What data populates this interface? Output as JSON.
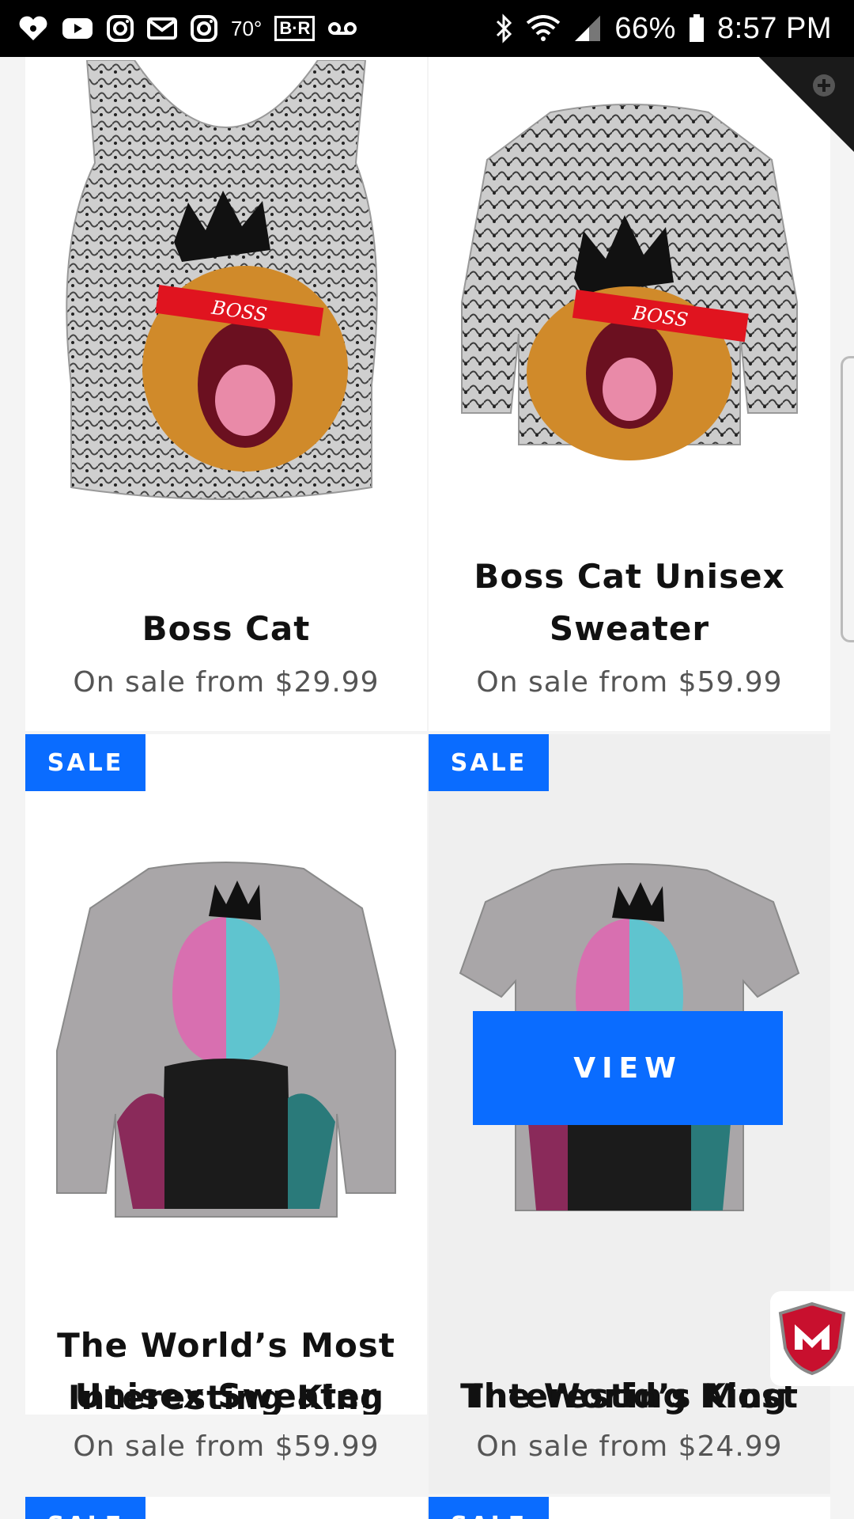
{
  "status_bar": {
    "temperature": "70°",
    "br_label": "B·R",
    "battery": "66%",
    "time": "8:57 PM",
    "icons": [
      "iheart-icon",
      "youtube-icon",
      "instagram-icon",
      "gmail-icon",
      "instagram-icon",
      "voicemail-icon",
      "bluetooth-icon",
      "wifi-icon",
      "signal-icon",
      "battery-icon"
    ]
  },
  "products": [
    {
      "title": "Boss Cat",
      "price": "On sale from $29.99",
      "sale": false,
      "image": "boss-cat-tank-image"
    },
    {
      "title_line1": "Boss Cat Unisex",
      "title_line2": "Sweater",
      "price": "On sale from $59.99",
      "sale": false,
      "image": "boss-cat-sweater-image"
    },
    {
      "badge": "SALE",
      "title_line1": "The World’s Most",
      "title_line2": "Interesting King",
      "title_line3": "Unisex Sweater",
      "price": "On sale from $59.99",
      "image": "world-king-sweater-image"
    },
    {
      "badge": "SALE",
      "title_line1": "The World’s Most",
      "title_line2": "Interesting King",
      "price": "On sale from $24.99",
      "view_label": "VIEW",
      "image": "world-king-tee-image"
    }
  ],
  "next_row_badges": [
    "SALE",
    "SALE"
  ],
  "colors": {
    "accent": "#0a6cff",
    "price_text": "#555555",
    "status_bar": "#000000"
  }
}
